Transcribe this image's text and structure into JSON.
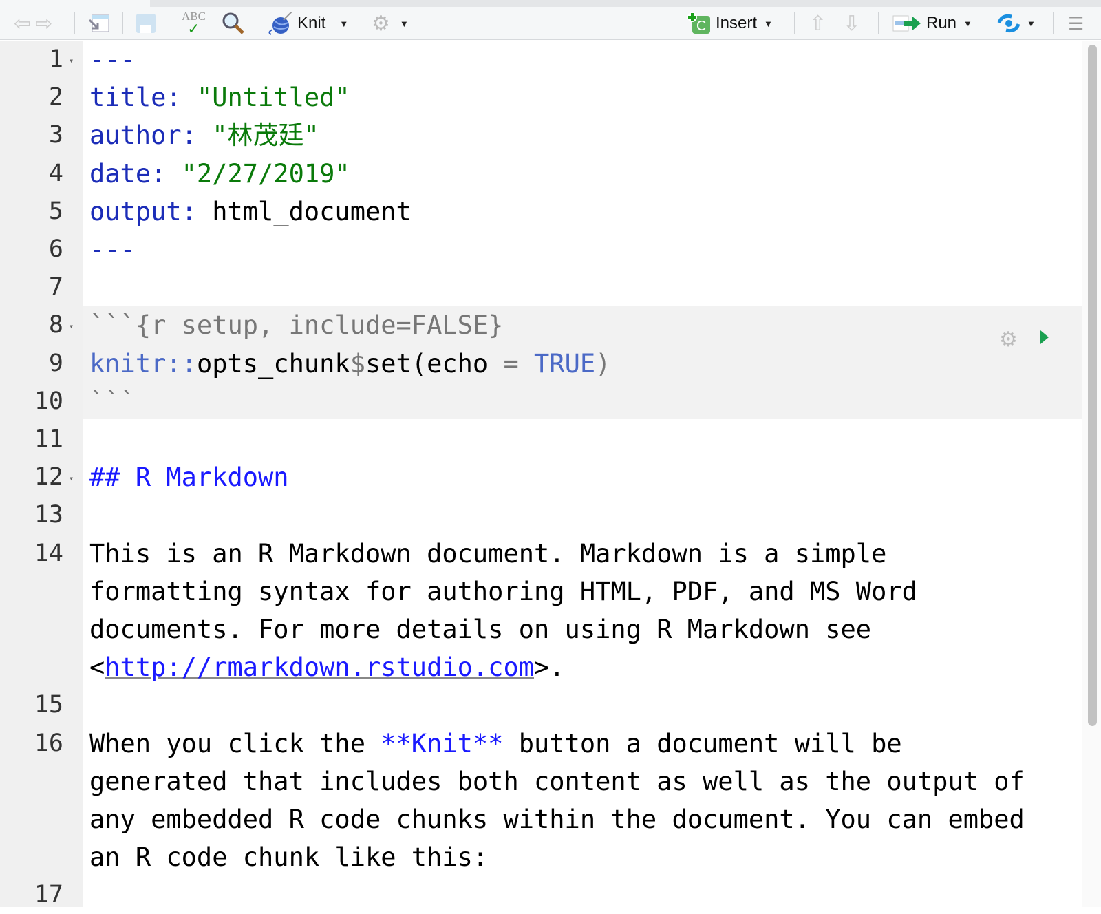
{
  "toolbar": {
    "knit_label": "Knit",
    "insert_label": "Insert",
    "run_label": "Run",
    "spellcheck_text": "ABC"
  },
  "lines": [
    {
      "n": "1",
      "tokens": [
        {
          "t": "---",
          "c": "k"
        }
      ]
    },
    {
      "n": "2",
      "tokens": [
        {
          "t": "title: ",
          "c": "k"
        },
        {
          "t": "\"Untitled\"",
          "c": "s"
        }
      ]
    },
    {
      "n": "3",
      "tokens": [
        {
          "t": "author: ",
          "c": "k"
        },
        {
          "t": "\"林茂廷\"",
          "c": "s"
        }
      ]
    },
    {
      "n": "4",
      "tokens": [
        {
          "t": "date: ",
          "c": "k"
        },
        {
          "t": "\"2/27/2019\"",
          "c": "s"
        }
      ]
    },
    {
      "n": "5",
      "tokens": [
        {
          "t": "output: ",
          "c": "k"
        },
        {
          "t": "html_document",
          "c": ""
        }
      ]
    },
    {
      "n": "6",
      "tokens": [
        {
          "t": "---",
          "c": "k"
        }
      ]
    },
    {
      "n": "7",
      "tokens": []
    },
    {
      "n": "8",
      "tokens": [
        {
          "t": "```{r setup, include=FALSE}",
          "c": "grey"
        }
      ]
    },
    {
      "n": "9",
      "tokens": [
        {
          "t": "knitr::",
          "c": "num"
        },
        {
          "t": "opts_chunk",
          "c": ""
        },
        {
          "t": "$",
          "c": "grey"
        },
        {
          "t": "set(echo ",
          "c": ""
        },
        {
          "t": "= ",
          "c": "grey"
        },
        {
          "t": "TRUE",
          "c": "num"
        },
        {
          "t": ")",
          "c": "grey"
        }
      ]
    },
    {
      "n": "10",
      "tokens": [
        {
          "t": "```",
          "c": "grey"
        }
      ]
    },
    {
      "n": "11",
      "tokens": []
    },
    {
      "n": "12",
      "tokens": [
        {
          "t": "## R Markdown",
          "c": "h"
        }
      ]
    },
    {
      "n": "13",
      "tokens": []
    },
    {
      "n": "14",
      "rows": [
        [
          {
            "t": "This is an R Markdown document. Markdown is a simple",
            "c": ""
          }
        ],
        [
          {
            "t": "formatting syntax for authoring HTML, PDF, and MS Word",
            "c": ""
          }
        ],
        [
          {
            "t": "documents. For more details on using R Markdown see",
            "c": ""
          }
        ],
        [
          {
            "t": "<",
            "c": ""
          },
          {
            "t": "http://rmarkdown.rstudio.com",
            "c": "link"
          },
          {
            "t": ">.",
            "c": ""
          }
        ]
      ]
    },
    {
      "n": "15",
      "tokens": []
    },
    {
      "n": "16",
      "rows": [
        [
          {
            "t": "When you click the ",
            "c": ""
          },
          {
            "t": "**Knit**",
            "c": "b"
          },
          {
            "t": " button a document will be",
            "c": ""
          }
        ],
        [
          {
            "t": "generated that includes both content as well as the output of",
            "c": ""
          }
        ],
        [
          {
            "t": "any embedded R code chunks within the document. You can embed",
            "c": ""
          }
        ],
        [
          {
            "t": "an R code chunk like this:",
            "c": ""
          }
        ]
      ]
    },
    {
      "n": "17",
      "tokens": []
    }
  ],
  "folds": [
    "1",
    "8",
    "12"
  ]
}
